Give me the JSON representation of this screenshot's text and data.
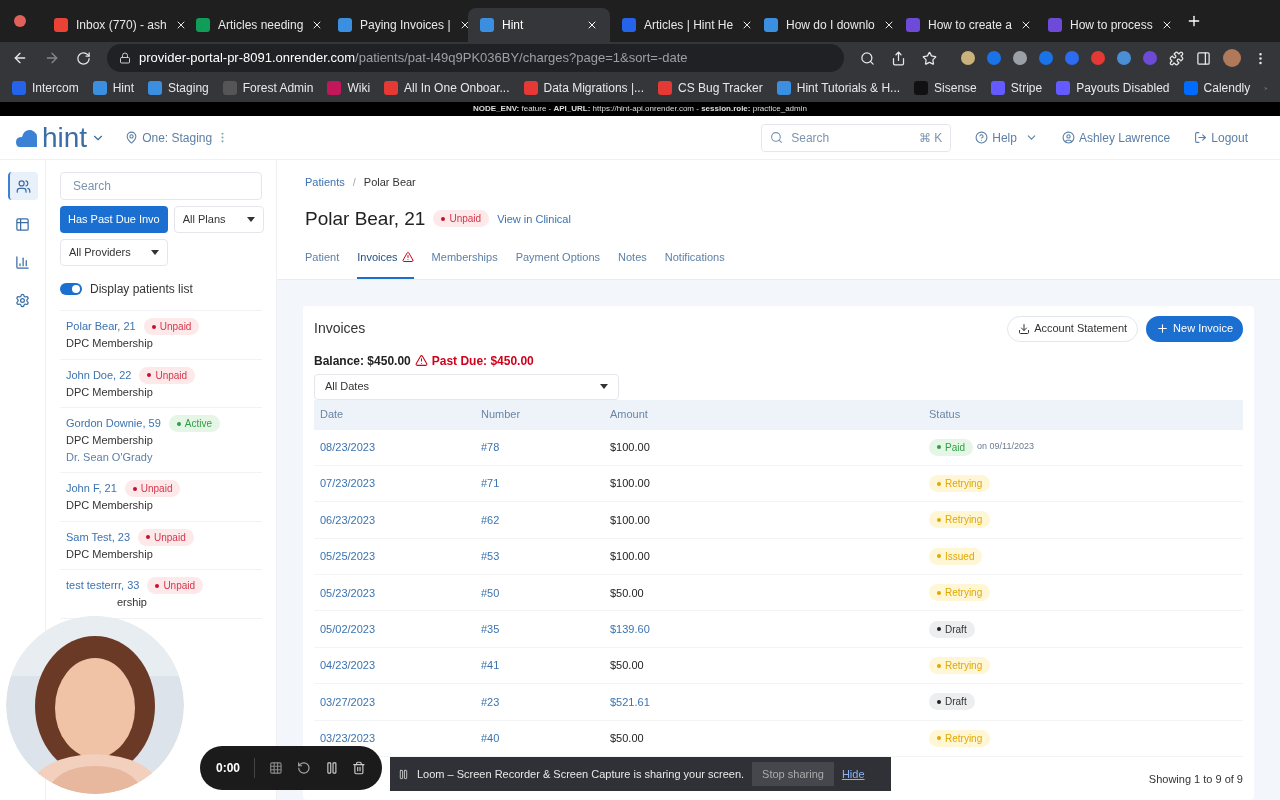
{
  "browser": {
    "tabs": [
      {
        "title": "Inbox (770) - ash",
        "kind": "gmail",
        "selected": false
      },
      {
        "title": "Articles needing",
        "kind": "sheets",
        "selected": false
      },
      {
        "title": "Paying Invoices |",
        "kind": "hint",
        "selected": false
      },
      {
        "title": "Hint",
        "kind": "hint",
        "selected": true
      },
      {
        "title": "Articles | Hint He",
        "kind": "intercom",
        "selected": false
      },
      {
        "title": "How do I downlo",
        "kind": "hint",
        "selected": false
      },
      {
        "title": "How to create a",
        "kind": "gear",
        "selected": false
      },
      {
        "title": "How to process",
        "kind": "gear",
        "selected": false
      }
    ],
    "url_host": "provider-portal-pr-8091.onrender.com",
    "url_path": "/patients/pat-I49q9PK036BY/charges?page=1&sort=-date",
    "bookmarks": [
      {
        "label": "Intercom",
        "kind": "intercom"
      },
      {
        "label": "Hint",
        "kind": "hint"
      },
      {
        "label": "Staging",
        "kind": "hint"
      },
      {
        "label": "Forest Admin",
        "kind": "forest"
      },
      {
        "label": "Wiki",
        "kind": "wiki"
      },
      {
        "label": "All In One Onboar...",
        "kind": "doc"
      },
      {
        "label": "Data Migrations |...",
        "kind": "doc"
      },
      {
        "label": "CS Bug Tracker",
        "kind": "doc"
      },
      {
        "label": "Hint Tutorials & H...",
        "kind": "hint"
      },
      {
        "label": "Sisense",
        "kind": "sisense"
      },
      {
        "label": "Stripe",
        "kind": "stripe"
      },
      {
        "label": "Payouts Disabled",
        "kind": "stripe"
      },
      {
        "label": "Calendly",
        "kind": "calendly"
      }
    ],
    "dev_banner": "**NODE_ENV:** feature - **API_URL:** https://hint-api.onrender.com - **session.role:** practice_admin"
  },
  "header": {
    "logo": "hint",
    "location": "One: Staging",
    "search_placeholder": "Search",
    "shortcut": "⌘ K",
    "help": "Help",
    "user": "Ashley Lawrence",
    "logout": "Logout"
  },
  "nav": [
    {
      "kind": "people",
      "selected": true
    },
    {
      "kind": "list",
      "selected": false
    },
    {
      "kind": "chart",
      "selected": false
    },
    {
      "kind": "gear",
      "selected": false
    }
  ],
  "sidebar": {
    "search_placeholder": "Search",
    "filters": [
      {
        "label": "Has Past Due Invo",
        "selected": true
      },
      {
        "label": "All Plans",
        "selected": false
      },
      {
        "label": "All Providers",
        "selected": false
      }
    ],
    "toggle": {
      "label": "Display patients list",
      "on": true
    },
    "patients": [
      {
        "name": "Polar Bear, 21",
        "status": "Unpaid",
        "kind": "unpaid",
        "lines": [
          "DPC Membership"
        ]
      },
      {
        "name": "John Doe, 22",
        "status": "Unpaid",
        "kind": "unpaid",
        "lines": [
          "DPC Membership"
        ]
      },
      {
        "name": "Gordon Downie, 59",
        "status": "Active",
        "kind": "active",
        "lines": [
          "DPC Membership",
          "Dr. Sean O'Grady"
        ]
      },
      {
        "name": "John F, 21",
        "status": "Unpaid",
        "kind": "unpaid",
        "lines": [
          "DPC Membership"
        ]
      },
      {
        "name": "Sam Test, 23",
        "status": "Unpaid",
        "kind": "unpaid",
        "lines": [
          "DPC Membership"
        ]
      },
      {
        "name": "test testerrr, 33",
        "status": "Unpaid",
        "kind": "unpaid",
        "lines": [
          "ership"
        ]
      }
    ]
  },
  "patient": {
    "breadcrumb": [
      "Patients",
      "/",
      "Polar Bear"
    ],
    "title": "Polar Bear, 21",
    "status": "Unpaid",
    "link": "View in Clinical",
    "tabs": [
      {
        "label": "Patient",
        "selected": false,
        "warning": false
      },
      {
        "label": "Invoices",
        "selected": true,
        "warning": true
      },
      {
        "label": "Memberships",
        "selected": false,
        "warning": false
      },
      {
        "label": "Payment Options",
        "selected": false,
        "warning": false
      },
      {
        "label": "Notes",
        "selected": false,
        "warning": false
      },
      {
        "label": "Notifications",
        "selected": false,
        "warning": false
      }
    ]
  },
  "invoices": {
    "title": "Invoices",
    "statement_button": "Account Statement",
    "new_button": "New Invoice",
    "balance": "Balance: $450.00",
    "past_due": "Past Due: $450.00",
    "date_filter": "All Dates",
    "columns": [
      "Date",
      "Number",
      "Amount",
      "Status"
    ],
    "rows": [
      {
        "date": "08/23/2023",
        "number": "#78",
        "amount": "$100.00",
        "amount_link": false,
        "status": "Paid",
        "kind": "paid",
        "note": "on 09/11/2023"
      },
      {
        "date": "07/23/2023",
        "number": "#71",
        "amount": "$100.00",
        "amount_link": false,
        "status": "Retrying",
        "kind": "retrying"
      },
      {
        "date": "06/23/2023",
        "number": "#62",
        "amount": "$100.00",
        "amount_link": false,
        "status": "Retrying",
        "kind": "retrying"
      },
      {
        "date": "05/25/2023",
        "number": "#53",
        "amount": "$100.00",
        "amount_link": false,
        "status": "Issued",
        "kind": "issued"
      },
      {
        "date": "05/23/2023",
        "number": "#50",
        "amount": "$50.00",
        "amount_link": false,
        "status": "Retrying",
        "kind": "retrying"
      },
      {
        "date": "05/02/2023",
        "number": "#35",
        "amount": "$139.60",
        "amount_link": true,
        "status": "Draft",
        "kind": "draft"
      },
      {
        "date": "04/23/2023",
        "number": "#41",
        "amount": "$50.00",
        "amount_link": false,
        "status": "Retrying",
        "kind": "retrying"
      },
      {
        "date": "03/27/2023",
        "number": "#23",
        "amount": "$521.61",
        "amount_link": true,
        "status": "Draft",
        "kind": "draft"
      },
      {
        "date": "03/23/2023",
        "number": "#40",
        "amount": "$50.00",
        "amount_link": false,
        "status": "Retrying",
        "kind": "retrying"
      }
    ],
    "footer": "Showing 1 to 9 of 9"
  },
  "loom": {
    "timer": "0:00",
    "message": "Loom – Screen Recorder & Screen Capture is sharing your screen.",
    "stop": "Stop sharing",
    "hide": "Hide"
  }
}
